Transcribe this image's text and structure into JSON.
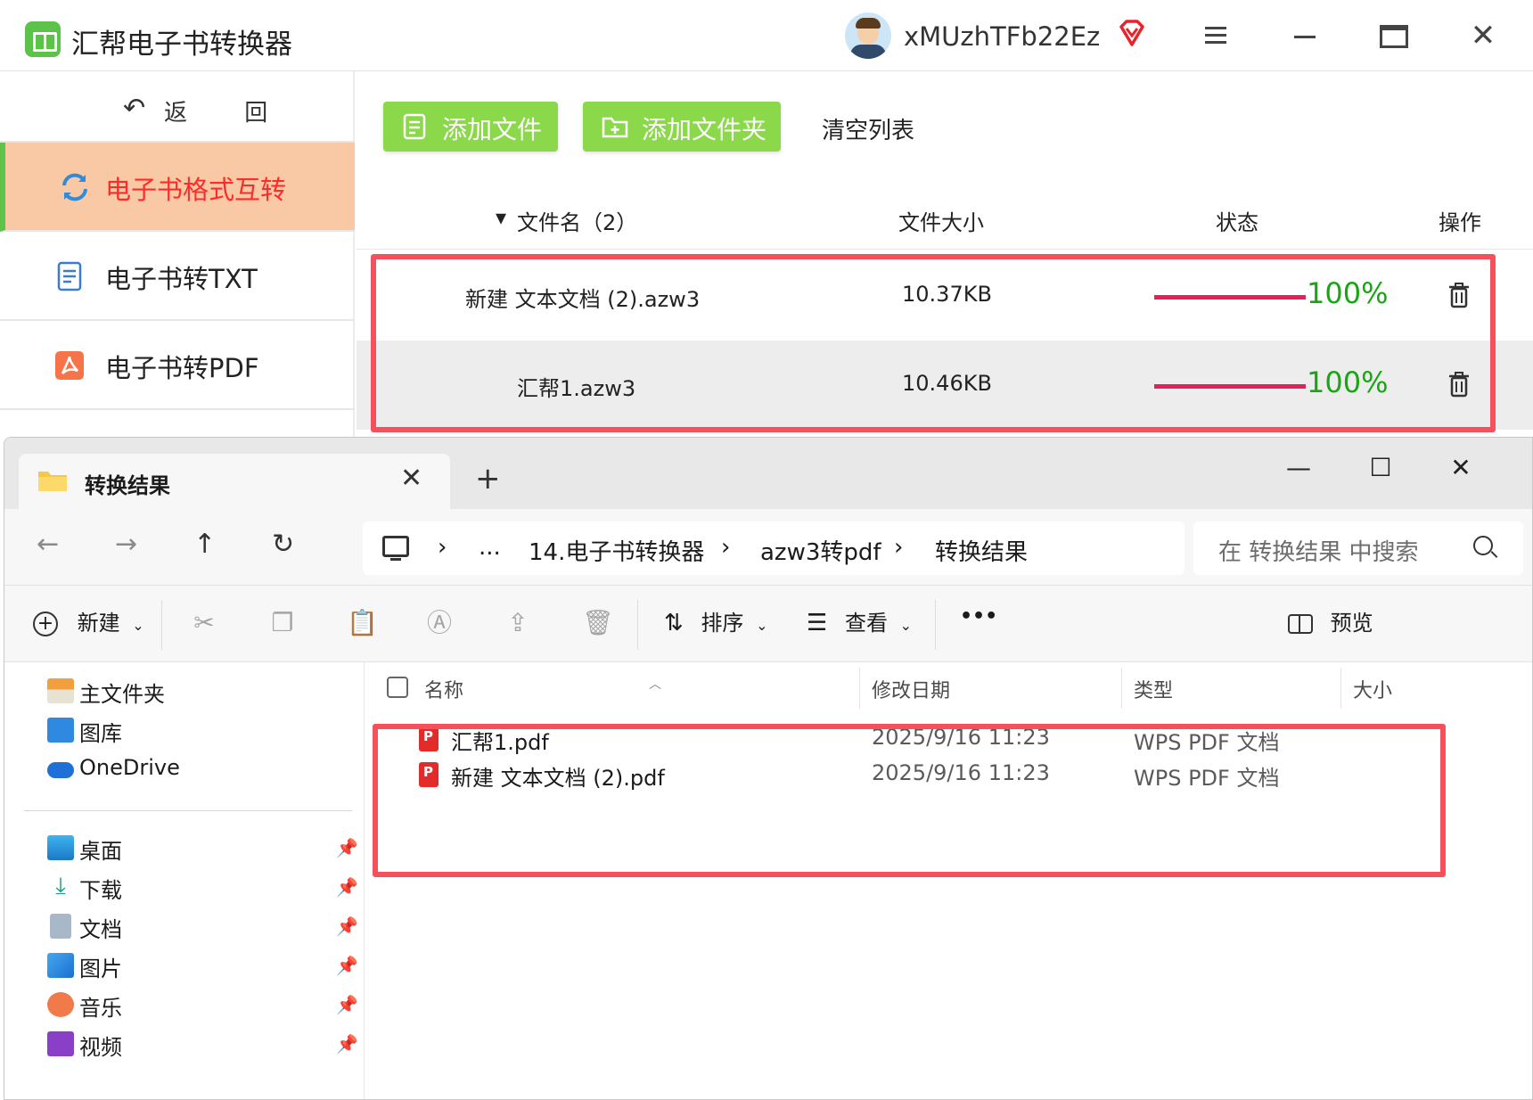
{
  "app": {
    "title": "汇帮电子书转换器",
    "username": "xMUzhTFb22Ez",
    "back_label": "返 回",
    "sidebar": [
      {
        "label": "电子书格式互转",
        "icon": "refresh-icon",
        "active": true
      },
      {
        "label": "电子书转TXT",
        "icon": "document-icon",
        "active": false
      },
      {
        "label": "电子书转PDF",
        "icon": "pdf-icon",
        "active": false
      }
    ],
    "toolbar": {
      "add_file": "添加文件",
      "add_folder": "添加文件夹",
      "clear": "清空列表"
    },
    "table": {
      "headers": {
        "name": "文件名（2）",
        "size": "文件大小",
        "status": "状态",
        "action": "操作"
      },
      "rows": [
        {
          "name": "新建 文本文档 (2).azw3",
          "size": "10.37KB",
          "progress": 100,
          "progress_label": "100%"
        },
        {
          "name": "汇帮1.azw3",
          "size": "10.46KB",
          "progress": 100,
          "progress_label": "100%"
        }
      ]
    },
    "colors": {
      "accent_green": "#8bd94a",
      "active_bg": "#f8c9a4",
      "active_text": "#ff2a2a",
      "progress_bar": "#e3205a",
      "progress_text": "#1aa514",
      "highlight_frame": "#f4515d"
    }
  },
  "explorer": {
    "tab_title": "转换结果",
    "breadcrumb": [
      "...",
      "14.电子书转换器",
      "azw3转pdf",
      "转换结果"
    ],
    "search_placeholder": "在 转换结果 中搜索",
    "commands": {
      "new": "新建",
      "sort": "排序",
      "view": "查看",
      "more": "•••",
      "preview": "预览"
    },
    "nav_pane": {
      "top": [
        "主文件夹",
        "图库",
        "OneDrive"
      ],
      "pinned": [
        "桌面",
        "下载",
        "文档",
        "图片",
        "音乐",
        "视频"
      ]
    },
    "columns": {
      "name": "名称",
      "modified": "修改日期",
      "type": "类型",
      "size": "大小"
    },
    "files": [
      {
        "name": "汇帮1.pdf",
        "modified": "2025/9/16 11:23",
        "type": "WPS PDF 文档"
      },
      {
        "name": "新建 文本文档 (2).pdf",
        "modified": "2025/9/16 11:23",
        "type": "WPS PDF 文档"
      }
    ]
  }
}
